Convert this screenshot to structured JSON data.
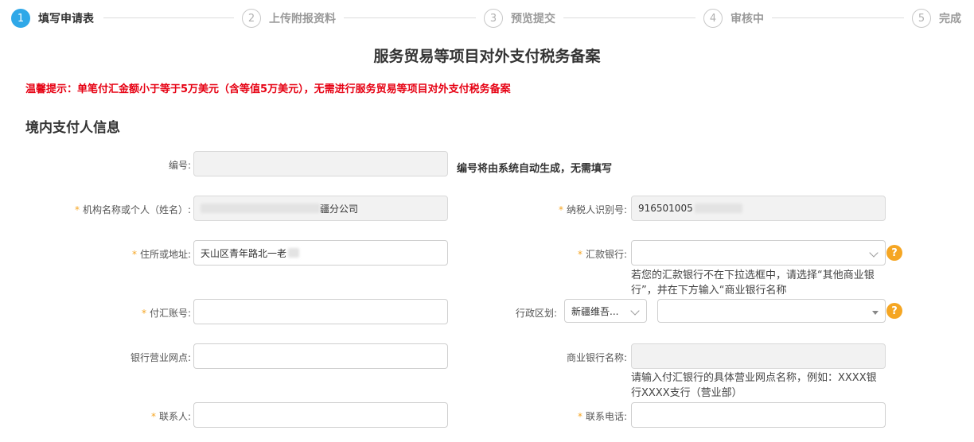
{
  "steps": [
    {
      "num": "1",
      "label": "填写申请表",
      "active": true
    },
    {
      "num": "2",
      "label": "上传附报资料",
      "active": false
    },
    {
      "num": "3",
      "label": "预览提交",
      "active": false
    },
    {
      "num": "4",
      "label": "审核中",
      "active": false
    },
    {
      "num": "5",
      "label": "完成",
      "active": false
    }
  ],
  "page_title": "服务贸易等项目对外支付税务备案",
  "tip": "温馨提示：单笔付汇金额小于等于5万美元（含等值5万美元），无需进行服务贸易等项目对外支付税务备案",
  "section_title": "境内支付人信息",
  "required_mark": "*",
  "form": {
    "number": {
      "label": "编号:",
      "value": "",
      "note": "编号将由系统自动生成，无需填写"
    },
    "org_name": {
      "label": "机构名称或个人（姓名）:",
      "value_suffix": "疆分公司"
    },
    "taxpayer_id": {
      "label": "纳税人识别号:",
      "value_prefix": "916501005"
    },
    "address": {
      "label": "住所或地址:",
      "value": "天山区青年路北一老"
    },
    "remit_bank": {
      "label": "汇款银行:",
      "value": "",
      "note": "若您的汇款银行不在下拉选框中，请选择“其他商业银行”，并在下方输入“商业银行名称"
    },
    "account_no": {
      "label": "付汇账号:",
      "value": ""
    },
    "admin_region": {
      "label": "行政区划:",
      "province": "新疆维吾...",
      "city": ""
    },
    "bank_branch": {
      "label": "银行营业网点:",
      "value": ""
    },
    "commercial_bank": {
      "label": "商业银行名称:",
      "value": "",
      "note": "请输入付汇银行的具体营业网点名称，例如：XXXX银行XXXX支行（营业部）"
    },
    "contact": {
      "label": "联系人:",
      "value": ""
    },
    "phone": {
      "label": "联系电话:",
      "value": ""
    }
  },
  "help_icon": "?",
  "colors": {
    "accent": "#2fa8e8",
    "warning": "#e60012",
    "help": "#f5a623"
  }
}
